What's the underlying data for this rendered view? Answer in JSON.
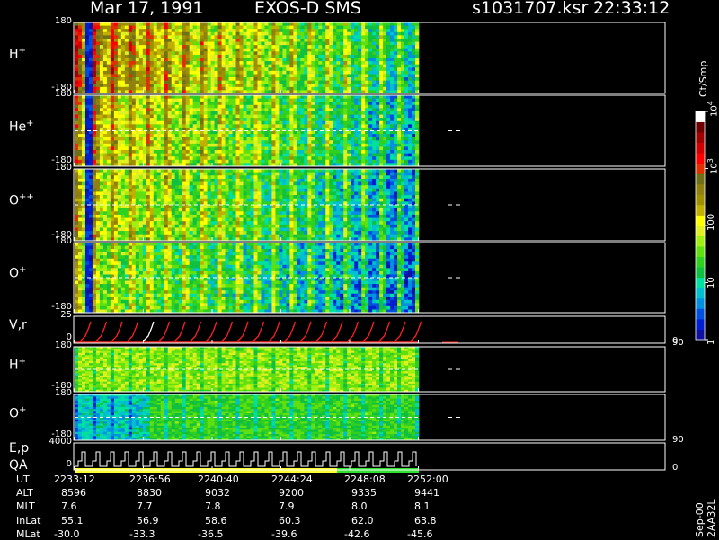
{
  "header": {
    "date": "Mar 17, 1991",
    "instrument": "EXOS-D SMS",
    "file": "s1031707.ksr",
    "time": "22:33:12"
  },
  "colors": {
    "panel_border": "#ffffff",
    "zero_line": "#ffffff",
    "curve_red": "#ff2020",
    "curve_white": "#ffffff",
    "qa_yellow": "#ffff30",
    "qa_green": "#30e030"
  },
  "panels": [
    {
      "label": "H",
      "sup": "+",
      "ytop": "180",
      "ybot": "-180"
    },
    {
      "label": "He",
      "sup": "+",
      "ytop": "180",
      "ybot": "-180"
    },
    {
      "label": "O",
      "sup": "++",
      "ytop": "180",
      "ybot": "-180"
    },
    {
      "label": "O",
      "sup": "+",
      "ytop": "180",
      "ybot": "-180"
    },
    {
      "label": "V,r",
      "sup": "",
      "ytop": "25",
      "ybot": "0",
      "right_top": "90",
      "right_bot": "0"
    },
    {
      "label": "H",
      "sup": "+",
      "ytop": "180",
      "ybot": "-180"
    },
    {
      "label": "O",
      "sup": "+",
      "ytop": "180",
      "ybot": "-180",
      "right_top": "90"
    },
    {
      "label": "E,p",
      "label2": "QA",
      "sup": "",
      "ytop": "4000",
      "ybot": "0",
      "right_bot": "0"
    }
  ],
  "colorbar": {
    "label": "Ct/Smp",
    "ticks": [
      {
        "text": "1",
        "frac": 0.0
      },
      {
        "text": "10",
        "frac": 0.25
      },
      {
        "text": "100",
        "frac": 0.5
      },
      {
        "text": "10",
        "sup": "3",
        "frac": 0.75
      },
      {
        "text": "10",
        "sup": "4",
        "frac": 1.0
      }
    ],
    "colors": [
      "#1010a0",
      "#0020d0",
      "#0050e0",
      "#0090e0",
      "#00c0d0",
      "#00e0a0",
      "#10c040",
      "#30d020",
      "#60e010",
      "#a0f010",
      "#e0f020",
      "#ffff00",
      "#c0b000",
      "#a09000",
      "#908010",
      "#707018",
      "#e03000",
      "#ff0000",
      "#d00000",
      "#a00000",
      "#700000",
      "#ffffff"
    ]
  },
  "footer": {
    "rows": [
      {
        "label": "UT",
        "values": [
          "2233:12",
          "2236:56",
          "2240:40",
          "2244:24",
          "2248:08",
          "2252:00"
        ]
      },
      {
        "label": "ALT",
        "values": [
          "8596",
          "8830",
          "9032",
          "9200",
          "9335",
          "9441"
        ]
      },
      {
        "label": "MLT",
        "values": [
          "7.6",
          "7.7",
          "7.8",
          "7.9",
          "8.0",
          "8.1"
        ]
      },
      {
        "label": "InLat",
        "values": [
          "55.1",
          "56.9",
          "58.6",
          "60.3",
          "62.0",
          "63.8"
        ]
      },
      {
        "label": "MLat",
        "values": [
          "-30.0",
          "-33.3",
          "-36.5",
          "-39.6",
          "-42.6",
          "-45.6"
        ]
      }
    ],
    "code": "Sep-00  2AA32L"
  },
  "chart_data": {
    "type": "heatmap",
    "title": "Mar 17, 1991   EXOS-D SMS",
    "x_ticks": [
      "2233:12",
      "2236:56",
      "2240:40",
      "2244:24",
      "2248:08",
      "2252:00"
    ],
    "y_axes": [
      {
        "panel": "H+",
        "ylim": [
          -180,
          180
        ]
      },
      {
        "panel": "He+",
        "ylim": [
          -180,
          180
        ]
      },
      {
        "panel": "O++",
        "ylim": [
          -180,
          180
        ]
      },
      {
        "panel": "O+",
        "ylim": [
          -180,
          180
        ]
      },
      {
        "panel": "V,r",
        "ylim": [
          0,
          25
        ],
        "y2lim": [
          0,
          90
        ]
      },
      {
        "panel": "H+",
        "ylim": [
          -180,
          180
        ]
      },
      {
        "panel": "O+",
        "ylim": [
          -180,
          180
        ]
      },
      {
        "panel": "E,p",
        "ylim": [
          0,
          4000
        ]
      }
    ],
    "colorbar": {
      "label": "Ct/Smp",
      "scale": "log",
      "range": [
        1,
        10000
      ]
    }
  }
}
